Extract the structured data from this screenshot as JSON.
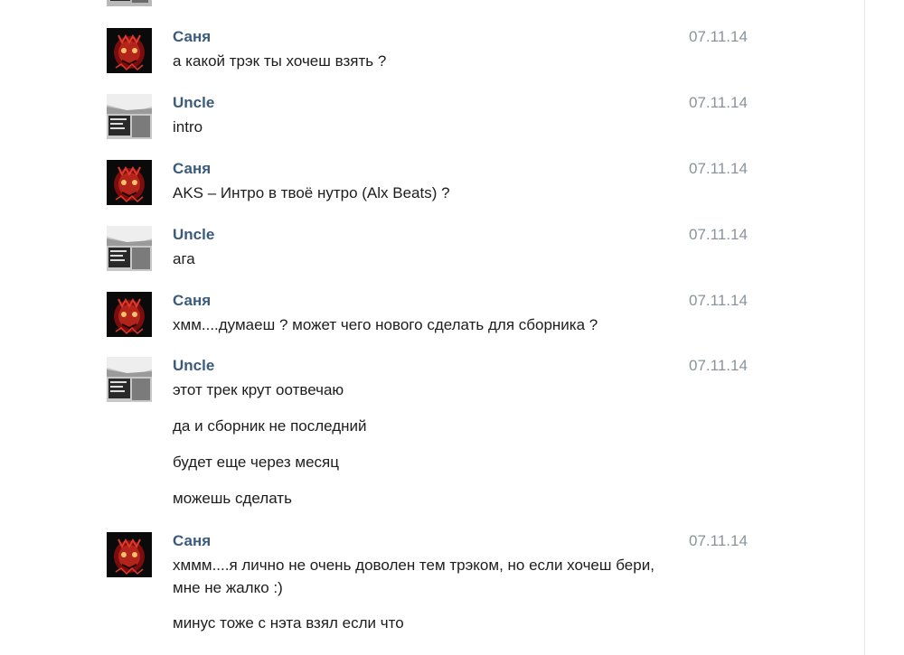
{
  "avatars": {
    "sanya": "sanya-avatar-icon",
    "uncle": "uncle-avatar-icon"
  },
  "colors": {
    "author": "#3a5b7c",
    "date": "#8a939c",
    "text": "#1d1d1d"
  },
  "messages": [
    {
      "author": "Саня",
      "date": "07.11.14",
      "lines": [
        "а какой трэк ты хочеш взять ?"
      ]
    },
    {
      "author": "Uncle",
      "date": "07.11.14",
      "lines": [
        "intro"
      ]
    },
    {
      "author": "Саня",
      "date": "07.11.14",
      "lines": [
        "AKS – Интро в твоё нутро (Alx Beats) ?"
      ]
    },
    {
      "author": "Uncle",
      "date": "07.11.14",
      "lines": [
        "ага"
      ]
    },
    {
      "author": "Саня",
      "date": "07.11.14",
      "lines": [
        "хмм....думаеш ? может чего нового сделать для сборника ?"
      ]
    },
    {
      "author": "Uncle",
      "date": "07.11.14",
      "lines": [
        "этот трек крут оотвечаю",
        "да и сборник не последний",
        "будет еще через месяц",
        "можешь сделать"
      ]
    },
    {
      "author": "Саня",
      "date": "07.11.14",
      "lines": [
        "хммм....я лично не очень доволен тем трэком, но если хочеш бери,",
        "мне не жалко :)",
        "минус тоже с нэта взял если что"
      ]
    }
  ]
}
